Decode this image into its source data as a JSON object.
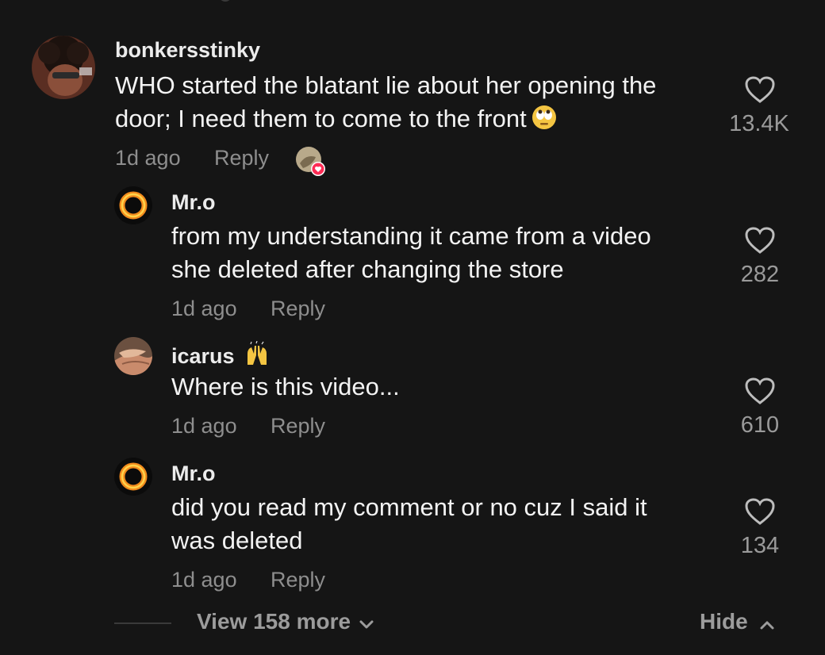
{
  "comments": [
    {
      "username": "bonkersstinky",
      "text_lines": [
        "WHO started the blatant lie about her opening the",
        "door; I need them to come to the front"
      ],
      "text_emoji": "face-with-rolling-eyes",
      "time": "1d ago",
      "reply_label": "Reply",
      "likes": "13.4K",
      "liked_by_creator": true
    },
    {
      "username": "Mr.o",
      "text_lines": [
        "from my understanding it came from a video",
        "she deleted after changing the store"
      ],
      "time": "1d ago",
      "reply_label": "Reply",
      "likes": "282"
    },
    {
      "username": "icarus",
      "username_emoji": "raising-hands",
      "text_lines": [
        "Where is this video..."
      ],
      "time": "1d ago",
      "reply_label": "Reply",
      "likes": "610"
    },
    {
      "username": "Mr.o",
      "text_lines": [
        "did you read my comment or no cuz I said it",
        "was deleted"
      ],
      "time": "1d ago",
      "reply_label": "Reply",
      "likes": "134"
    }
  ],
  "footer": {
    "view_more_label": "View 158 more",
    "hide_label": "Hide"
  },
  "colors": {
    "background": "#151515",
    "primary_text": "#f3f3f3",
    "secondary_text": "#8e8e8e",
    "heart_badge": "#fe2c55"
  },
  "icons": {
    "like": "heart-outline-icon",
    "view_more": "chevron-down-icon",
    "hide": "chevron-up-icon",
    "creator_like": "heart-badge-icon"
  }
}
